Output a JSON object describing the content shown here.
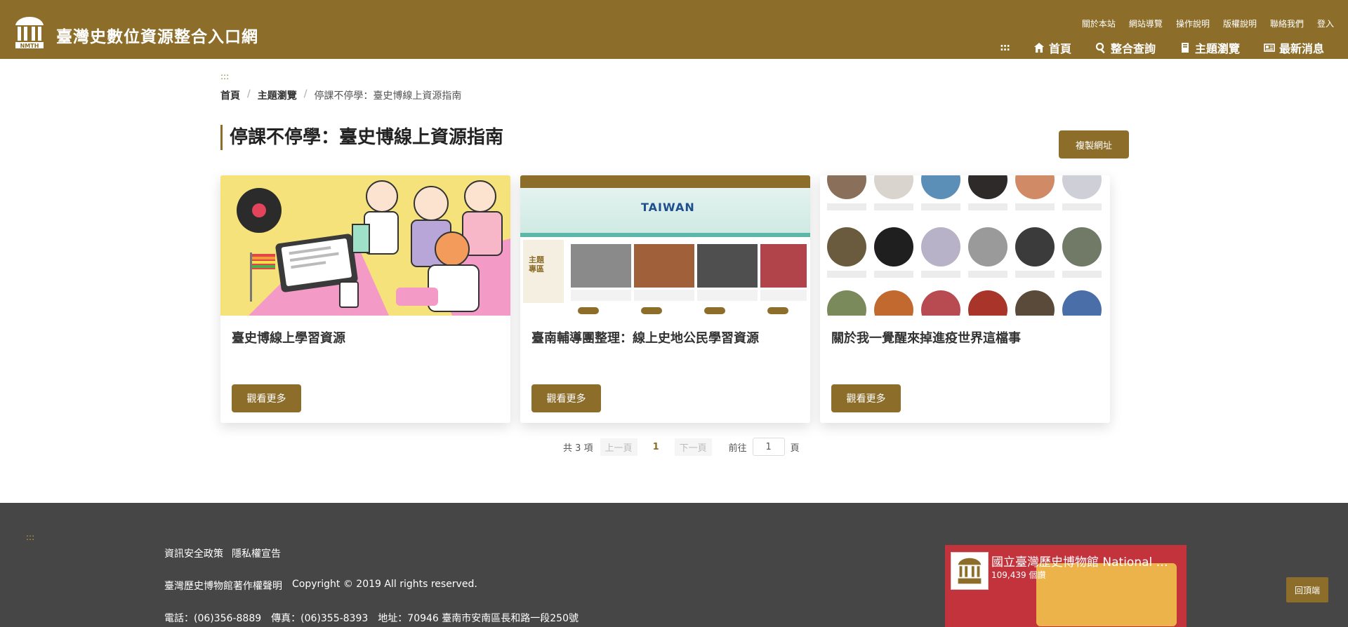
{
  "header": {
    "site_title": "臺灣史數位資源整合入口網",
    "logo_text": "NMTH",
    "util_nav": [
      "關於本站",
      "網站導覽",
      "操作說明",
      "版權說明",
      "聯絡我們",
      "登入"
    ],
    "main_nav": {
      "accesskey": ":::",
      "home": "首頁",
      "search": "整合查詢",
      "browse": "主題瀏覽",
      "news": "最新消息"
    },
    "accent_color": "#8c6e2a"
  },
  "content": {
    "accesskey": ":::",
    "breadcrumb": [
      "首頁",
      "主題瀏覽",
      "停課不停學：臺史博線上資源指南"
    ],
    "breadcrumb_sep": "/",
    "page_title": "停課不停學：臺史博線上資源指南",
    "copy_url_label": "複製網址",
    "cards": [
      {
        "title": "臺史博線上學習資源",
        "button": "觀看更多"
      },
      {
        "title": "臺南輔導團整理：線上史地公民學習資源",
        "button": "觀看更多"
      },
      {
        "title": "關於我一覺醒來掉進疫世界這檔事",
        "button": "觀看更多"
      }
    ],
    "card2_image": {
      "banner_text": "TAIWAN",
      "side_label": "主題專區"
    }
  },
  "pagination": {
    "total": "共 3 項",
    "prev": "上一頁",
    "current": "1",
    "next": "下一頁",
    "goto": "前往",
    "goto_value": "1",
    "unit": "頁"
  },
  "footer": {
    "accesskey": ":::",
    "links": [
      "資訊安全政策",
      "隱私權宣告"
    ],
    "copyright_owner": "臺灣歷史博物館著作權聲明",
    "copyright": "Copyright © 2019 All rights reserved.",
    "phone": "電話：(06)356-8889",
    "fax": "傳真：(06)355-8393",
    "address": "地址：70946 臺南市安南區長和路一段250號",
    "facebook": {
      "page_name": "國立臺灣歷史博物館 National Museum of Taiwan History",
      "likes": "109,439 個讚"
    }
  },
  "back_to_top": "回頂端"
}
